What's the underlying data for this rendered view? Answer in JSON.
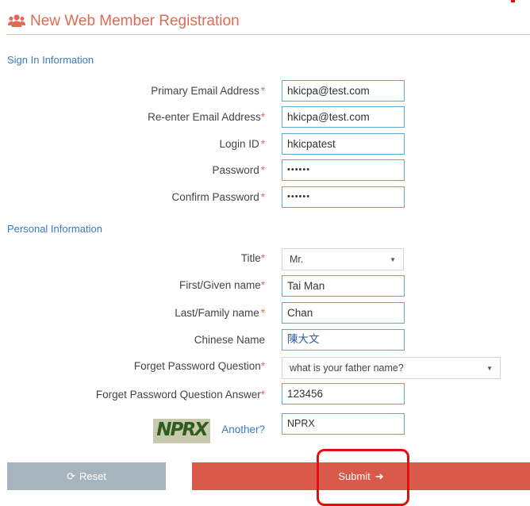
{
  "header": {
    "title": "New Web Member Registration",
    "icon": "users-icon"
  },
  "sections": {
    "sign_in": "Sign In Information",
    "personal": "Personal Information"
  },
  "required_marker": "*",
  "fields": {
    "primary_email": {
      "label": "Primary Email Address",
      "value": "hkicpa@test.com"
    },
    "reenter_email": {
      "label": "Re-enter Email Address",
      "value": "hkicpa@test.com"
    },
    "login_id": {
      "label": "Login ID",
      "value": "hkicpatest"
    },
    "password": {
      "label": "Password",
      "value": "••••••"
    },
    "confirm_password": {
      "label": "Confirm Password",
      "value": "••••••"
    },
    "title": {
      "label": "Title",
      "value": "Mr."
    },
    "first_name": {
      "label": "First/Given name",
      "value": "Tai Man"
    },
    "last_name": {
      "label": "Last/Family name",
      "value": "Chan"
    },
    "chinese_name": {
      "label": "Chinese Name",
      "value": "陳大文"
    },
    "forget_question": {
      "label": "Forget Password Question",
      "value": "what is your father name?"
    },
    "forget_answer": {
      "label": "Forget Password Question Answer",
      "value": "123456"
    },
    "captcha": {
      "image_text": "NPRX",
      "another_link": "Another?",
      "value": "NPRX"
    }
  },
  "buttons": {
    "reset": "Reset",
    "submit": "Submit"
  },
  "colors": {
    "accent": "#e06a53",
    "section": "#3a7abf",
    "submit_bg": "#d9594a",
    "reset_bg": "#a5b4bd",
    "highlight": "#e01010"
  }
}
